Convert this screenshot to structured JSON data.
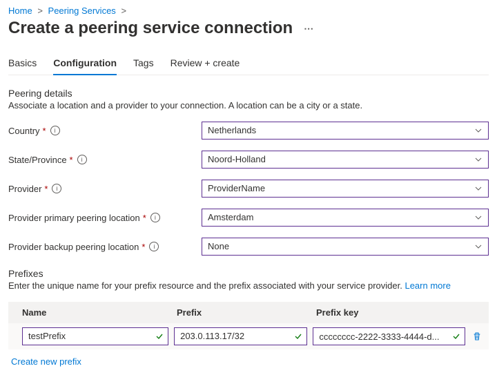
{
  "breadcrumb": {
    "home": "Home",
    "peering_services": "Peering Services"
  },
  "page_title": "Create a peering service connection",
  "tabs": {
    "basics": "Basics",
    "configuration": "Configuration",
    "tags": "Tags",
    "review_create": "Review + create"
  },
  "peering_details": {
    "heading": "Peering details",
    "description": "Associate a location and a provider to your connection. A location can be a city or a state.",
    "fields": {
      "country": {
        "label": "Country",
        "value": "Netherlands"
      },
      "state_province": {
        "label": "State/Province",
        "value": "Noord-Holland"
      },
      "provider": {
        "label": "Provider",
        "value": "ProviderName"
      },
      "primary_location": {
        "label": "Provider primary peering location",
        "value": "Amsterdam"
      },
      "backup_location": {
        "label": "Provider backup peering location",
        "value": "None"
      }
    }
  },
  "prefixes": {
    "heading": "Prefixes",
    "description_pre": "Enter the unique name for your prefix resource and the prefix associated with your service provider. ",
    "learn_more": "Learn more",
    "columns": {
      "name": "Name",
      "prefix": "Prefix",
      "prefix_key": "Prefix key"
    },
    "rows": [
      {
        "name": "testPrefix",
        "prefix": "203.0.113.17/32",
        "prefix_key": "cccccccc-2222-3333-4444-d..."
      }
    ],
    "create_new": "Create new prefix"
  }
}
